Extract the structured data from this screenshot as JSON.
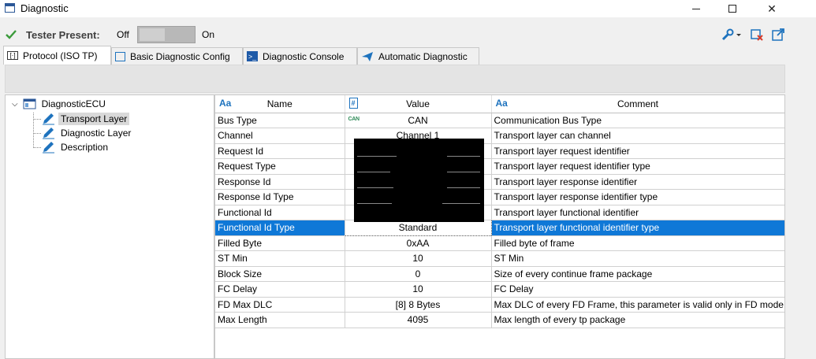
{
  "window": {
    "title": "Diagnostic",
    "min_label": "",
    "max_label": "",
    "close_label": "✕"
  },
  "tester": {
    "label": "Tester Present:",
    "off": "Off",
    "on": "On"
  },
  "tabs": [
    {
      "label": "Protocol (ISO TP)",
      "icon": "protocol-icon"
    },
    {
      "label": "Basic Diagnostic Config",
      "icon": "config-icon"
    },
    {
      "label": "Diagnostic Console",
      "icon": "console-icon"
    },
    {
      "label": "Automatic Diagnostic",
      "icon": "send-icon"
    }
  ],
  "tree": {
    "root": "DiagnosticECU",
    "children": [
      "Transport Layer",
      "Diagnostic Layer",
      "Description"
    ]
  },
  "grid": {
    "columns": [
      {
        "label": "Name",
        "icon": "Aa"
      },
      {
        "label": "Value",
        "icon": "#"
      },
      {
        "label": "Comment",
        "icon": "Aa"
      }
    ],
    "can_badge": "CAN",
    "rows": [
      {
        "name": "Bus Type",
        "value": "CAN",
        "comment": "Communication Bus Type"
      },
      {
        "name": "Channel",
        "value": "Channel 1",
        "comment": "Transport layer can channel"
      },
      {
        "name": "Request Id",
        "value": "",
        "comment": "Transport layer request identifier"
      },
      {
        "name": "Request Type",
        "value": "",
        "comment": "Transport layer request identifier type"
      },
      {
        "name": "Response Id",
        "value": "",
        "comment": "Transport layer response identifier"
      },
      {
        "name": "Response Id Type",
        "value": "",
        "comment": "Transport layer response identifier type"
      },
      {
        "name": "Functional Id",
        "value": "",
        "comment": "Transport layer functional identifier"
      },
      {
        "name": "Functional Id Type",
        "value": "Standard",
        "comment": "Transport layer functional identifier type"
      },
      {
        "name": "Filled Byte",
        "value": "0xAA",
        "comment": "Filled byte of frame"
      },
      {
        "name": "ST Min",
        "value": "10",
        "comment": "ST Min"
      },
      {
        "name": "Block Size",
        "value": "0",
        "comment": "Size of every continue frame package"
      },
      {
        "name": "FC Delay",
        "value": "10",
        "comment": "FC Delay"
      },
      {
        "name": "FD Max DLC",
        "value": "[8]  8 Bytes",
        "comment": "Max DLC of every FD Frame, this parameter is valid only in FD mode"
      },
      {
        "name": "Max Length",
        "value": "4095",
        "comment": "Max length of every tp package"
      }
    ]
  },
  "colors": {
    "selection": "#0f78d7",
    "accent": "#1e73be",
    "check": "#3a9a3a"
  }
}
